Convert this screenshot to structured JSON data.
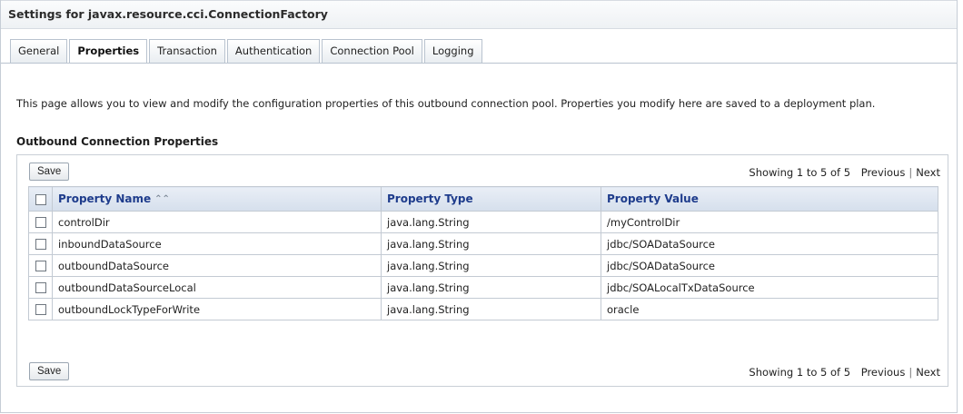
{
  "window": {
    "title": "Settings for javax.resource.cci.ConnectionFactory"
  },
  "tabs": [
    {
      "label": "General",
      "active": false
    },
    {
      "label": "Properties",
      "active": true
    },
    {
      "label": "Transaction",
      "active": false
    },
    {
      "label": "Authentication",
      "active": false
    },
    {
      "label": "Connection Pool",
      "active": false
    },
    {
      "label": "Logging",
      "active": false
    }
  ],
  "description": "This page allows you to view and modify the configuration properties of this outbound connection pool. Properties you modify here are saved to a deployment plan.",
  "section": {
    "title": "Outbound Connection Properties"
  },
  "toolbar": {
    "save_label": "Save",
    "showing": "Showing 1 to 5 of 5",
    "previous": "Previous",
    "next": "Next"
  },
  "table": {
    "headers": {
      "name": "Property Name",
      "type": "Property Type",
      "value": "Property Value"
    },
    "sort_icon": "sort-ascending-icon",
    "header_color": "#1e3c8c",
    "rows": [
      {
        "name": "controlDir",
        "type": "java.lang.String",
        "value": "/myControlDir"
      },
      {
        "name": "inboundDataSource",
        "type": "java.lang.String",
        "value": "jdbc/SOADataSource"
      },
      {
        "name": "outboundDataSource",
        "type": "java.lang.String",
        "value": "jdbc/SOADataSource"
      },
      {
        "name": "outboundDataSourceLocal",
        "type": "java.lang.String",
        "value": "jdbc/SOALocalTxDataSource"
      },
      {
        "name": "outboundLockTypeForWrite",
        "type": "java.lang.String",
        "value": "oracle"
      }
    ]
  }
}
